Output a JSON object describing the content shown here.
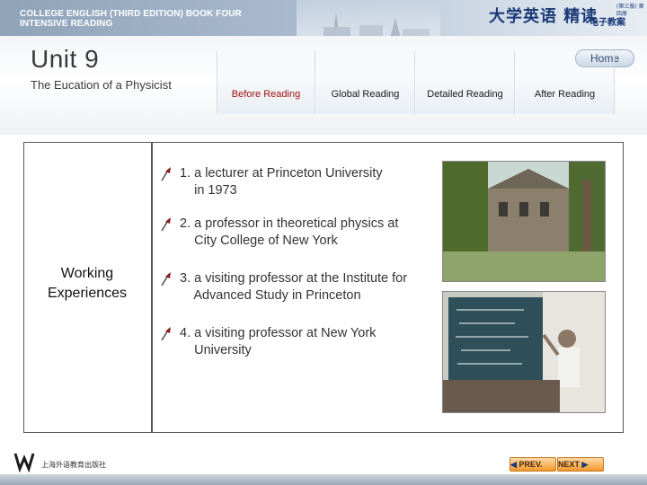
{
  "header": {
    "series_line1": "COLLEGE ENGLISH (THIRD EDITION) BOOK FOUR",
    "series_line2": "INTENSIVE READING",
    "brand_cn": "大学英语 精读",
    "brand_small": "(第三版) 第四册",
    "brand_sub": "电子教案",
    "unit_title": "Unit 9",
    "unit_subtitle": "The Eucation of a Physicist",
    "home_label": "Home"
  },
  "tabs": [
    {
      "label": "Before Reading",
      "active": true
    },
    {
      "label": "Global Reading",
      "active": false
    },
    {
      "label": "Detailed Reading",
      "active": false
    },
    {
      "label": "After Reading",
      "active": false
    }
  ],
  "content": {
    "side_label": "Working Experiences",
    "items": [
      "1. a lecturer at Princeton University\n    in 1973",
      "2. a professor in theoretical physics at\n    City College of New York",
      "3. a visiting professor at the Institute for\n    Advanced Study in Princeton",
      "4. a visiting professor at New York\n    University"
    ]
  },
  "footer": {
    "publisher": "上海外语教育出版社",
    "prev_label": "PREV.",
    "next_label": "NEXT"
  },
  "colors": {
    "active_tab_text": "#a01010",
    "frame_border": "#555555",
    "nav_button": "#f39a2b"
  }
}
